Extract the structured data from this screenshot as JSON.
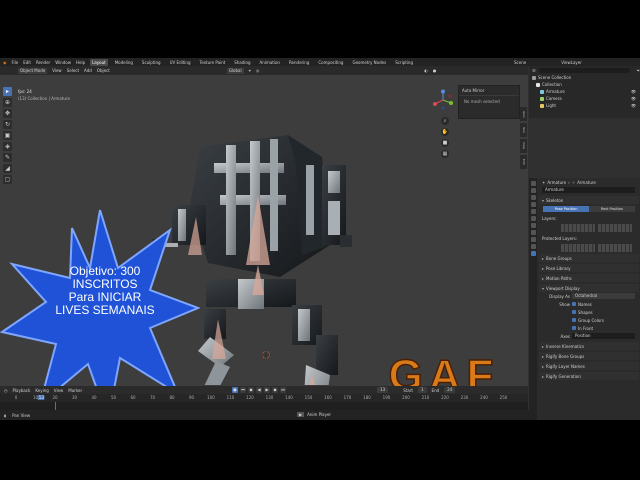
{
  "menubar": {
    "items": [
      "File",
      "Edit",
      "Render",
      "Window",
      "Help"
    ],
    "workspaces": [
      "Layout",
      "Modeling",
      "Sculpting",
      "UV Editing",
      "Texture Paint",
      "Shading",
      "Animation",
      "Rendering",
      "Compositing",
      "Geometry Nodes",
      "Scripting"
    ],
    "active_workspace": "Layout",
    "scene": "Scene",
    "view_layer": "ViewLayer"
  },
  "viewport_header": {
    "mode": "Object Mode",
    "menus": [
      "View",
      "Select",
      "Add",
      "Object"
    ],
    "transform": "Global",
    "options": "Options"
  },
  "viewport": {
    "fps": "fps: 24",
    "info": "(13) Collection | Armature",
    "npanel_title": "Auto Mirror",
    "npanel_message": "No mesh selected",
    "side_tabs": [
      "Item",
      "Tool",
      "View",
      "Edit"
    ]
  },
  "overlay": {
    "promo_line1": "Objetivo: 300",
    "promo_line2": "INSCRITOS",
    "promo_line3": "Para INICIAR",
    "promo_line4": "LIVES SEMANAIS",
    "logo_text": "GAF"
  },
  "timeline": {
    "menus": [
      "Playback",
      "Keying",
      "View",
      "Marker"
    ],
    "current_frame": "13",
    "start_label": "Start",
    "start_value": "1",
    "end_label": "End",
    "end_value": "24",
    "ruler_ticks": [
      "0",
      "10",
      "13",
      "20",
      "30",
      "40",
      "50",
      "60",
      "70",
      "80",
      "90",
      "100",
      "110",
      "120",
      "130",
      "140",
      "150",
      "160",
      "170",
      "180",
      "190",
      "200",
      "210",
      "220",
      "230",
      "240",
      "250"
    ],
    "current_tick": "13"
  },
  "statusbar": {
    "left": "Pan View",
    "center": "Anim Player",
    "version": "3.1.2"
  },
  "outliner": {
    "rows": [
      {
        "label": "Scene Collection",
        "color": "#d0d0d0",
        "icon_color": "#9a9a9a"
      },
      {
        "label": "Collection",
        "color": "#d0d0d0",
        "icon_color": "#e5e5e5"
      },
      {
        "label": "Armature",
        "color": "#d0d0d0",
        "icon_color": "#7ec9e0"
      },
      {
        "label": "Camera",
        "color": "#d0d0d0",
        "icon_color": "#9bd16c"
      },
      {
        "label": "Light",
        "color": "#d0d0d0",
        "icon_color": "#e8c860"
      }
    ]
  },
  "properties": {
    "context": [
      "Armature",
      "Armature"
    ],
    "name_field": "Armature",
    "skeleton_header": "Skeleton",
    "pose_position": "Pose Position",
    "rest_position": "Rest Position",
    "layers_label": "Layers:",
    "protected_label": "Protected Layers:",
    "sections_closed": [
      "Bone Groups",
      "Pose Library",
      "Motion Paths"
    ],
    "viewport_display_header": "Viewport Display",
    "display_as_label": "Display As",
    "display_as_value": "Octahedral",
    "show_label": "Show",
    "show_options": [
      "Names",
      "Shapes",
      "Group Colors",
      "In Front"
    ],
    "axes_label": "Axes",
    "axes_value": "Position",
    "sections_bottom": [
      "Inverse Kinematics",
      "Rigify Bone Groups",
      "Rigify Layer Names",
      "Rigify Generation"
    ]
  },
  "colors": {
    "accent": "#4772b3",
    "burst": "#1f52d6",
    "logo_orange": "#e07a1c"
  }
}
